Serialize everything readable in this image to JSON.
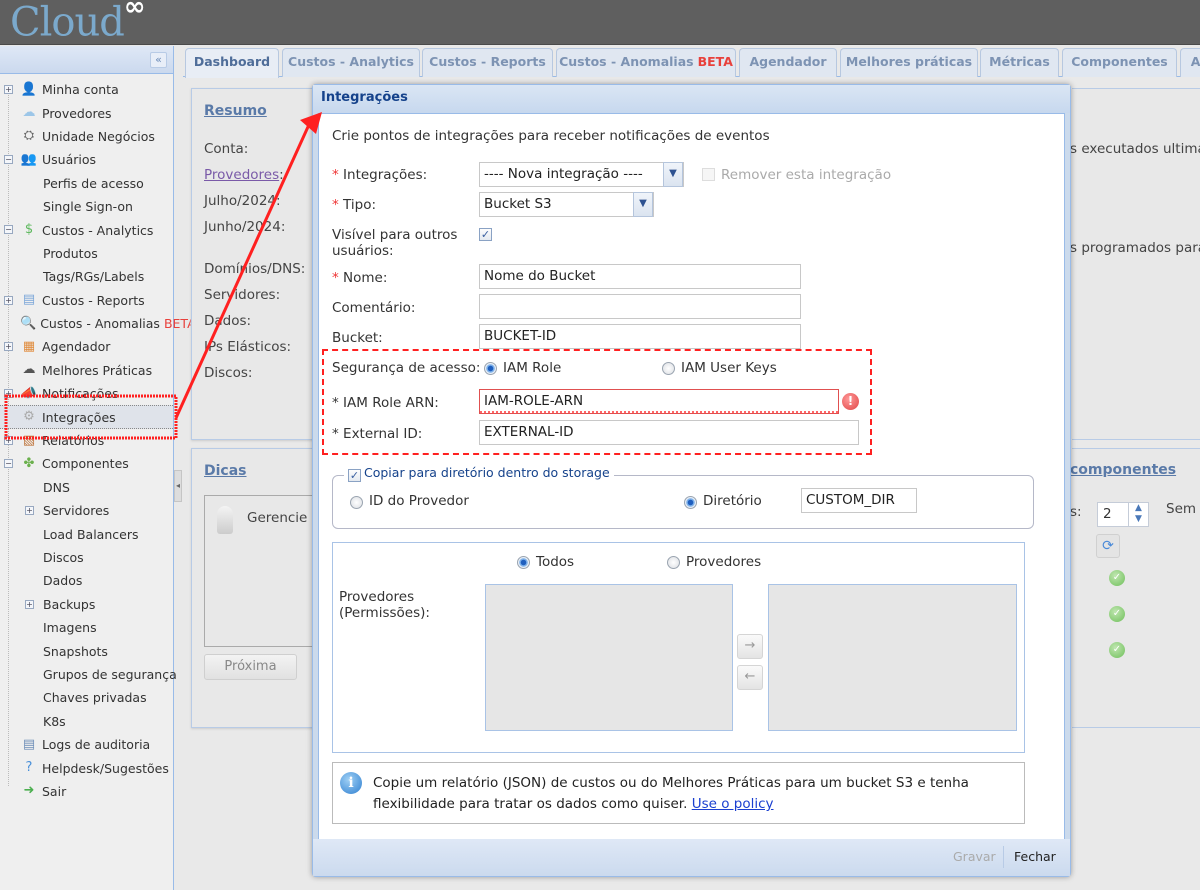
{
  "app": {
    "logo_text": "Cloud",
    "logo_symbol": "∞"
  },
  "sidebar": {
    "collapse_icon": "«",
    "items": [
      {
        "label": "Minha conta",
        "icon": "user-icon",
        "expander": "+"
      },
      {
        "label": "Provedores",
        "icon": "cloud-icon"
      },
      {
        "label": "Unidade Negócios",
        "icon": "org-chart-icon"
      },
      {
        "label": "Usuários",
        "icon": "users-icon",
        "expander": "−"
      },
      {
        "label": "Perfis de acesso"
      },
      {
        "label": "Single Sign-on"
      },
      {
        "label": "Custos - Analytics",
        "icon": "dollar-icon",
        "expander": "−"
      },
      {
        "label": "Produtos"
      },
      {
        "label": "Tags/RGs/Labels"
      },
      {
        "label": "Custos - Reports",
        "icon": "document-icon",
        "expander": "+"
      },
      {
        "label": "Custos - Anomalias",
        "badge": "BETA",
        "icon": "magnifier-chart-icon"
      },
      {
        "label": "Agendador",
        "icon": "calendar-icon",
        "expander": "+"
      },
      {
        "label": "Melhores Práticas",
        "icon": "cloud-check-icon"
      },
      {
        "label": "Notificações",
        "icon": "megaphone-icon",
        "expander": "+"
      },
      {
        "label": "Integrações",
        "icon": "gears-icon",
        "selected": true
      },
      {
        "label": "Relatórios",
        "icon": "report-icon",
        "expander": "+"
      },
      {
        "label": "Componentes",
        "icon": "puzzle-icon",
        "expander": "−"
      },
      {
        "label": "DNS"
      },
      {
        "label": "Servidores",
        "expander": "+"
      },
      {
        "label": "Load Balancers"
      },
      {
        "label": "Discos"
      },
      {
        "label": "Dados"
      },
      {
        "label": "Backups",
        "expander": "+"
      },
      {
        "label": "Imagens"
      },
      {
        "label": "Snapshots"
      },
      {
        "label": "Grupos de segurança"
      },
      {
        "label": "Chaves privadas"
      },
      {
        "label": "K8s"
      },
      {
        "label": "Logs de auditoria",
        "icon": "log-icon"
      },
      {
        "label": "Helpdesk/Sugestões",
        "icon": "help-icon"
      },
      {
        "label": "Sair",
        "icon": "exit-icon"
      }
    ]
  },
  "tabs": [
    {
      "label": "Dashboard",
      "active": true
    },
    {
      "label": "Custos - Analytics"
    },
    {
      "label": "Custos - Reports"
    },
    {
      "label": "Custos - Anomalias",
      "badge": "BETA"
    },
    {
      "label": "Agendador"
    },
    {
      "label": "Melhores práticas"
    },
    {
      "label": "Métricas"
    },
    {
      "label": "Componentes"
    },
    {
      "label": "Au"
    }
  ],
  "dashboard": {
    "resumo": {
      "title": "Resumo",
      "labels": [
        "Conta:",
        "Provedores",
        "Julho/2024:",
        "Junho/2024:",
        "Domínios/DNS:",
        "Servidores:",
        "Dados:",
        "IPs Elásticos:",
        "Discos:"
      ]
    },
    "right_text_1": "s executados ultimar",
    "right_text_2": "s programados para",
    "dicas": {
      "title": "Dicas",
      "tip_text": "Gerencie m",
      "next_button": "Próxima"
    },
    "componentes": {
      "title": "componentes",
      "label_fragment": "s:",
      "spinner_value": "2",
      "sem_text": "Sem s"
    }
  },
  "modal": {
    "title": "Integrações",
    "intro": "Crie pontos de integrações para receber notificações de eventos",
    "fields": {
      "integracoes": {
        "label": "Integrações:",
        "value": "---- Nova integração ----"
      },
      "remover": {
        "label": "Remover esta integração",
        "checked": false,
        "disabled": true
      },
      "tipo": {
        "label": "Tipo:",
        "value": "Bucket S3"
      },
      "visivel": {
        "label": "Visível para outros usuários:",
        "checked": true
      },
      "nome": {
        "label": "Nome:",
        "value": "Nome do Bucket"
      },
      "comentario": {
        "label": "Comentário:",
        "value": ""
      },
      "bucket": {
        "label": "Bucket:",
        "value": "BUCKET-ID"
      },
      "seguranca": {
        "label": "Segurança de acesso:",
        "options": [
          "IAM Role",
          "IAM User Keys"
        ],
        "selected": "IAM Role"
      },
      "role_arn": {
        "label": "* IAM Role ARN:",
        "value": "IAM-ROLE-ARN",
        "error": true
      },
      "external_id": {
        "label": "* External ID:",
        "value": "EXTERNAL-ID"
      }
    },
    "copy_section": {
      "legend": "Copiar para diretório dentro do storage",
      "checked": true,
      "options": [
        "ID do Provedor",
        "Diretório"
      ],
      "selected": "Diretório",
      "dir_value": "CUSTOM_DIR"
    },
    "providers_section": {
      "options": [
        "Todos",
        "Provedores"
      ],
      "selected": "Todos",
      "label": "Provedores (Permissões):",
      "move_right_icon": "→",
      "move_left_icon": "←"
    },
    "info": {
      "text": "Copie um relatório (JSON) de custos ou do Melhores Práticas para um bucket S3 e tenha flexibilidade para tratar os dados como quiser.",
      "link": "Use o policy"
    },
    "footer": {
      "save": "Gravar",
      "close": "Fechar"
    }
  },
  "colors": {
    "annotation": "#ff2020",
    "beta": "#e8413c",
    "header_text": "#15428b"
  }
}
